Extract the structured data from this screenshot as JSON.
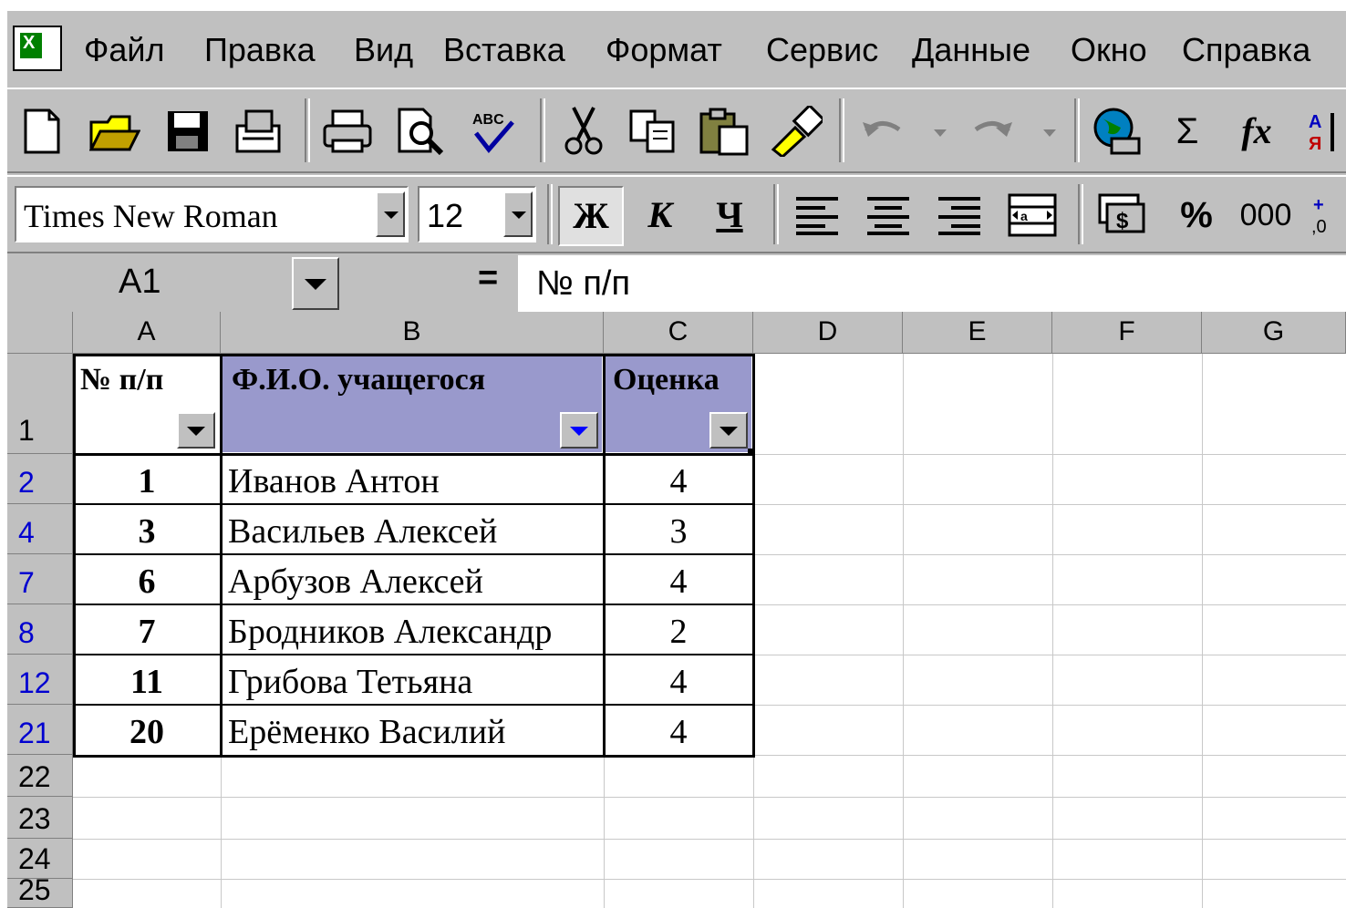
{
  "menu": [
    "Файл",
    "Правка",
    "Вид",
    "Вставка",
    "Формат",
    "Сервис",
    "Данные",
    "Окно",
    "Справка"
  ],
  "formatting": {
    "font_name": "Times New Roman",
    "font_size": "12",
    "bold_label": "Ж",
    "italic_label": "К",
    "underline_label": "Ч",
    "percent_label": "%",
    "thousands_label": "000",
    "sum_label": "Σ",
    "function_label": "fx"
  },
  "formula_bar": {
    "name_box": "A1",
    "equals": "=",
    "content": "№ п/п"
  },
  "columns": [
    "A",
    "B",
    "C",
    "D",
    "E",
    "F",
    "G"
  ],
  "header_row": {
    "row_number": "1",
    "a": "№ п/п",
    "b": "Ф.И.О. учащегося",
    "c": "Оценка"
  },
  "rows": [
    {
      "row": "2",
      "num": "1",
      "name": "Иванов Антон",
      "grade": "4"
    },
    {
      "row": "4",
      "num": "3",
      "name": "Васильев Алексей",
      "grade": "3"
    },
    {
      "row": "7",
      "num": "6",
      "name": "Арбузов Алексей",
      "grade": "4"
    },
    {
      "row": "8",
      "num": "7",
      "name": "Бродников Александр",
      "grade": "2"
    },
    {
      "row": "12",
      "num": "11",
      "name": "Грибова Тетьяна",
      "grade": "4"
    },
    {
      "row": "21",
      "num": "20",
      "name": "Ерёменко  Василий",
      "grade": "4"
    }
  ],
  "empty_rows": [
    "22",
    "23",
    "24",
    "25"
  ],
  "colors": {
    "window": "#c0c0c0",
    "filter_header": "#9999cc",
    "filtered_row_number": "#0000d0"
  }
}
